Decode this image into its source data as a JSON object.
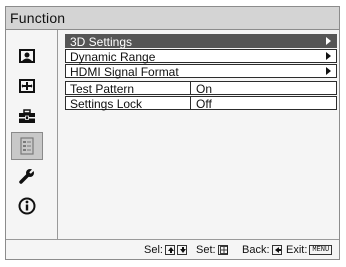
{
  "window": {
    "title": "Function"
  },
  "sidebar": {
    "icons": [
      {
        "name": "picture-icon"
      },
      {
        "name": "screen-icon"
      },
      {
        "name": "setup-icon"
      },
      {
        "name": "function-icon",
        "active": true
      },
      {
        "name": "installation-icon"
      },
      {
        "name": "information-icon"
      }
    ]
  },
  "menu": {
    "items": [
      {
        "label": "3D Settings",
        "value": "",
        "has_submenu": true,
        "selected": true
      },
      {
        "label": "Dynamic Range",
        "value": "",
        "has_submenu": true
      },
      {
        "label": "HDMI Signal Format",
        "value": "",
        "has_submenu": true
      },
      {
        "label": "Test Pattern",
        "value": "On"
      },
      {
        "label": "Settings Lock",
        "value": "Off"
      }
    ]
  },
  "footer": {
    "select_label": "Sel:",
    "set_label": "Set:",
    "back_label": "Back:",
    "exit_label": "Exit:",
    "exit_key": "MENU"
  },
  "colors": {
    "selected_row_bg": "#555555",
    "title_bar_bg": "#d4d4d4",
    "panel_bg": "#f5f5f5"
  }
}
